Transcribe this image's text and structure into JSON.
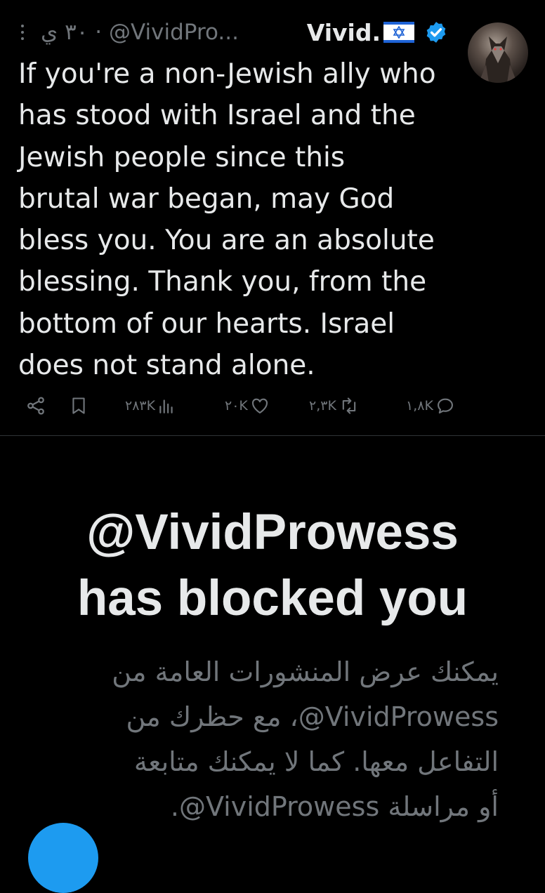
{
  "tweet": {
    "display_name": "Vivid.",
    "handle_truncated": "@VividPro...",
    "time_label": "٣٠ ي",
    "separator": "·",
    "text": "If you're a non-Jewish ally who\nhas stood with Israel and the\nJewish people since this\nbrutal war began, may God\nbless you. You are an absolute\nblessing. Thank you, from the\nbottom of our hearts. Israel\ndoes not stand alone.",
    "stats": {
      "views": "٢٨٣K",
      "likes": "٢٠K",
      "reposts": "٢,٣K",
      "replies": "١,٨K"
    }
  },
  "blocked": {
    "title_line1": "@VividProwess",
    "title_line2": "has blocked you",
    "description": "يمكنك عرض المنشورات العامة من VividProwess@، مع حظرك من التفاعل معها. كما لا يمكنك متابعة أو مراسلة VividProwess@."
  },
  "colors": {
    "background": "#000000",
    "primary_text": "#e7e9ea",
    "secondary_text": "#71767b",
    "accent": "#1d9bf0"
  },
  "icons": [
    "more-icon",
    "flag-israel-icon",
    "verified-badge-icon",
    "share-icon",
    "bookmark-icon",
    "views-icon",
    "like-icon",
    "repost-icon",
    "reply-icon"
  ]
}
